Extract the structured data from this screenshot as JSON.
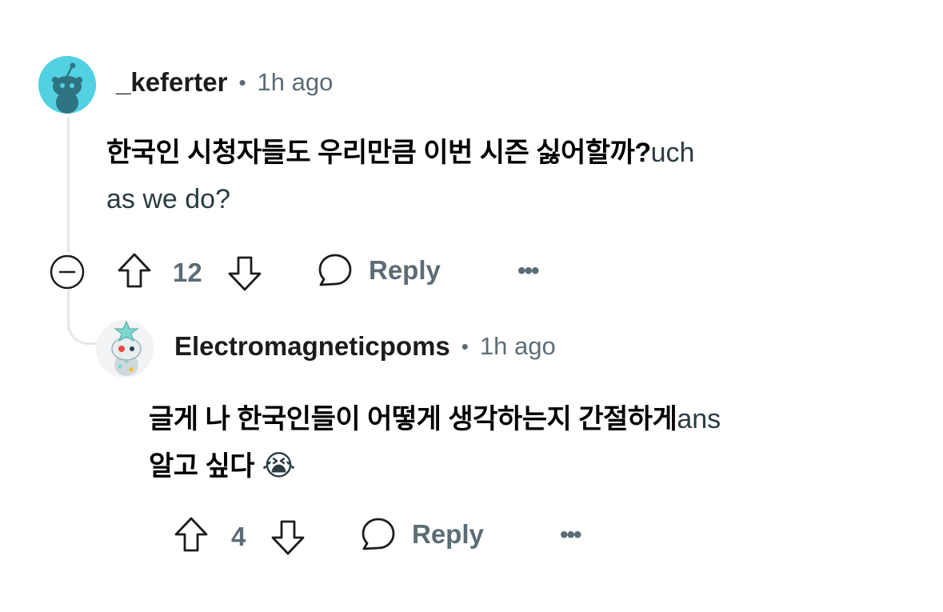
{
  "comments": [
    {
      "author": "_keferter",
      "separator": "•",
      "time": "1h ago",
      "text_ko": "한국인 시청자들도 우리만큼 이번 시즌 싫어할까?",
      "text_en_tail": "uch",
      "text_line2": "as we do?",
      "votes": "12",
      "reply_label": "Reply",
      "more_label": "•••",
      "avatar_icon": "reddit-snoo-avatar"
    },
    {
      "author": "Electromagneticpoms",
      "separator": "•",
      "time": "1h ago",
      "text_ko_line1": "글게 나 한국인들이 어떻게 생각하는지 간절하게",
      "text_en_tail": "ans",
      "text_ko_line2": "알고 싶다",
      "emoji": "😭",
      "votes": "4",
      "reply_label": "Reply",
      "more_label": "•••",
      "avatar_icon": "reddit-snoo-avatar-star"
    }
  ],
  "colors": {
    "meta": "#5c6c74",
    "thread_line": "#e5e8ea",
    "avatar1_bg": "#52d1e3"
  },
  "icons": [
    "collapse-icon",
    "upvote-icon",
    "downvote-icon",
    "comment-icon",
    "more-icon"
  ]
}
